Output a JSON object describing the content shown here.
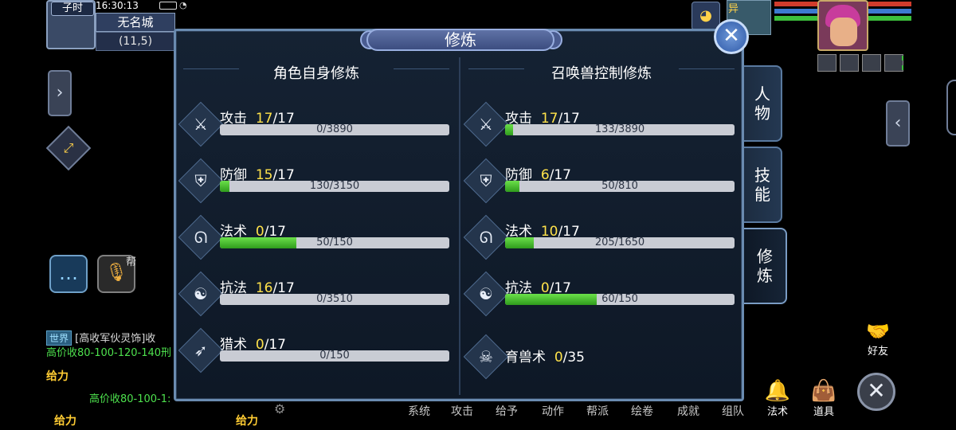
{
  "hud": {
    "shichen": "子时",
    "clock": "16:30:13",
    "city": "无名城",
    "coords": "(11,5)",
    "bang_label": "帮",
    "pet_badge": "异"
  },
  "chat": {
    "world_tag": "世界",
    "line1": "[高收军伙灵饰]收",
    "line2": "高价收80-100-120-140刑",
    "give_label": "给力",
    "line3": "高价收80-100-1:"
  },
  "dialog": {
    "title": "修炼",
    "close": "✕"
  },
  "left_panel": {
    "header": "角色自身修炼",
    "rows": [
      {
        "name": "攻击",
        "level": "17",
        "max": "/17",
        "progress": "0/3890",
        "fill": 0,
        "icon": "sword-icon",
        "glyph": "⚔"
      },
      {
        "name": "防御",
        "level": "15",
        "max": "/17",
        "progress": "130/3150",
        "fill": 0.041,
        "icon": "shield-icon",
        "glyph": "⛨"
      },
      {
        "name": "法术",
        "level": "0",
        "max": "/17",
        "progress": "50/150",
        "fill": 0.333,
        "icon": "magic-staff-icon",
        "glyph": "ᘏ"
      },
      {
        "name": "抗法",
        "level": "16",
        "max": "/17",
        "progress": "0/3510",
        "fill": 0,
        "icon": "yin-yang-icon",
        "glyph": "☯"
      },
      {
        "name": "猎术",
        "level": "0",
        "max": "/17",
        "progress": "0/150",
        "fill": 0,
        "icon": "bow-icon",
        "glyph": "➶"
      }
    ]
  },
  "right_panel": {
    "header": "召唤兽控制修炼",
    "rows": [
      {
        "name": "攻击",
        "level": "17",
        "max": "/17",
        "progress": "133/3890",
        "fill": 0.034,
        "icon": "sword-icon",
        "glyph": "⚔"
      },
      {
        "name": "防御",
        "level": "6",
        "max": "/17",
        "progress": "50/810",
        "fill": 0.062,
        "icon": "shield-icon",
        "glyph": "⛨"
      },
      {
        "name": "法术",
        "level": "10",
        "max": "/17",
        "progress": "205/1650",
        "fill": 0.124,
        "icon": "magic-staff-icon",
        "glyph": "ᘏ"
      },
      {
        "name": "抗法",
        "level": "0",
        "max": "/17",
        "progress": "60/150",
        "fill": 0.4,
        "icon": "yin-yang-icon",
        "glyph": "☯"
      }
    ],
    "beast": {
      "name": "育兽术",
      "level": "0",
      "max": "/35",
      "icon": "beast-skull-icon",
      "glyph": "☠"
    }
  },
  "side_tabs": {
    "character": [
      "人",
      "物"
    ],
    "skills": [
      "技",
      "能"
    ],
    "cultivation": [
      "修",
      "炼"
    ]
  },
  "bottom_menu": {
    "items": [
      "系统",
      "攻击",
      "给予",
      "动作",
      "帮派",
      "绘卷",
      "成就",
      "组队"
    ],
    "skill": "法术",
    "bag": "道具"
  },
  "friend_label": "好友",
  "colors": {
    "level_current": "#ffe24a",
    "progress_fill": "#3cc82c",
    "dialog_border": "#6a8bb0",
    "chat_green": "#4de04d"
  }
}
